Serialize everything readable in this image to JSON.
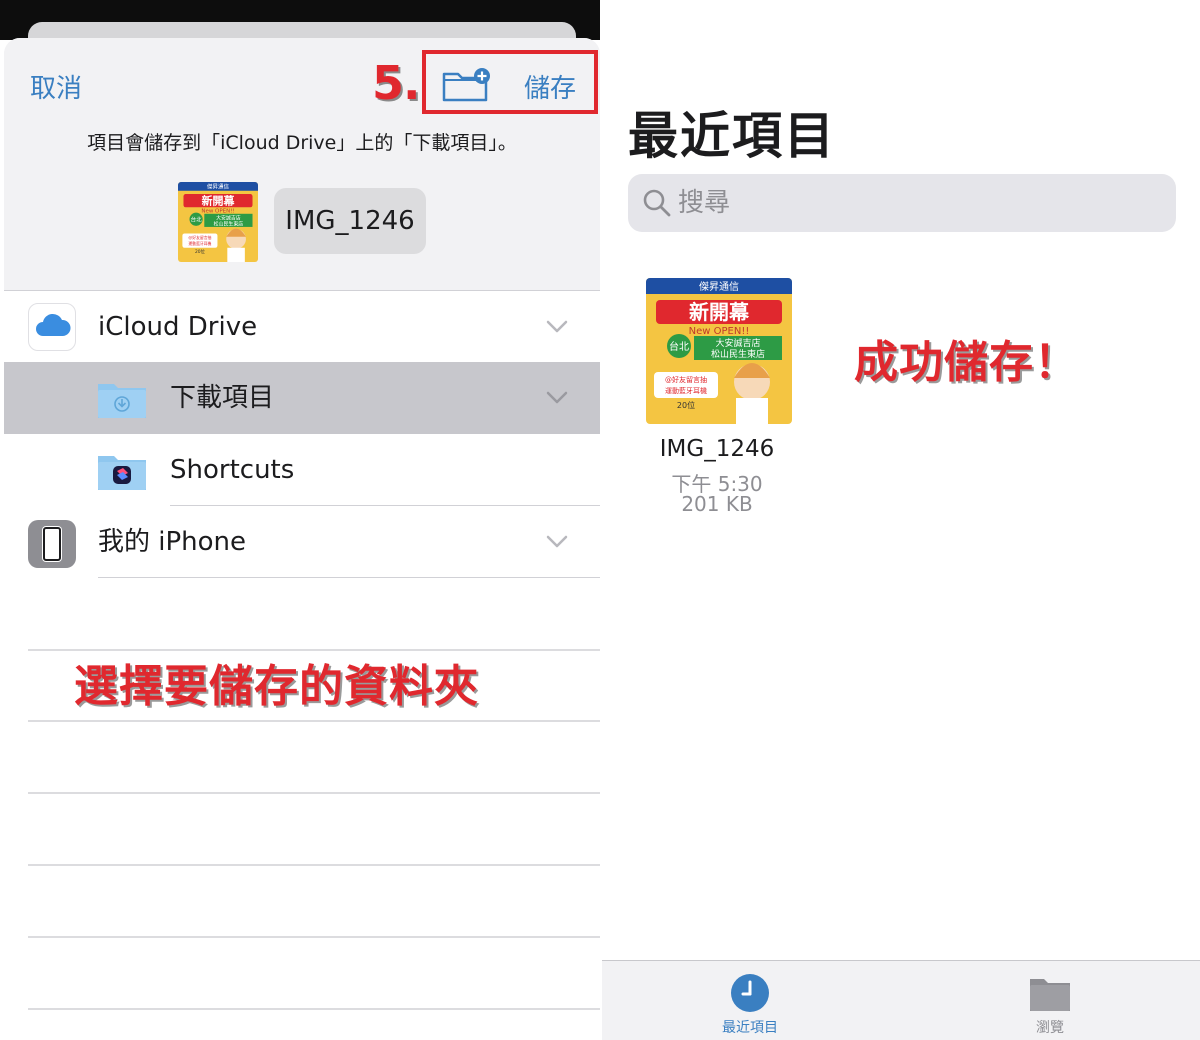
{
  "left": {
    "header": {
      "cancel_label": "取消",
      "step_label": "5.",
      "new_folder_icon": "folder-plus-icon",
      "save_label": "儲存"
    },
    "save_info": "項目會儲存到「iCloud Drive」上的「下載項目」。",
    "file": {
      "name": "IMG_1246",
      "thumbnail_icon": "image-thumbnail-icon"
    },
    "locations": [
      {
        "label": "iCloud Drive",
        "icon": "icloud-icon",
        "expanded": true
      },
      {
        "label": "下載項目",
        "icon": "download-folder-icon",
        "selected": true
      },
      {
        "label": "Shortcuts",
        "icon": "shortcuts-folder-icon"
      },
      {
        "label": "我的 iPhone",
        "icon": "iphone-icon",
        "expanded": false
      }
    ],
    "annotation": "選擇要儲存的資料夾"
  },
  "right": {
    "title": "最近項目",
    "search": {
      "placeholder": "搜尋"
    },
    "files": [
      {
        "name": "IMG_1246",
        "time": "下午 5:30",
        "size": "201 KB"
      }
    ],
    "annotation": "成功儲存！",
    "tabs": [
      {
        "label": "最近項目",
        "icon": "clock-icon",
        "active": true
      },
      {
        "label": "瀏覽",
        "icon": "folder-icon",
        "active": false
      }
    ]
  },
  "colors": {
    "accent": "#3a7fc1",
    "annotation": "#e0282e",
    "selected_row": "#c7c7cc",
    "sheet_bg": "#f2f2f4"
  },
  "thumbnail": {
    "banner": "傑昇通信",
    "headline": "新開幕",
    "subtitle": "New OPEN!!",
    "city": "台北",
    "store_1": "大安誠吉店",
    "store_2": "松山民生東店",
    "promo_1": "@好友留言抽",
    "promo_2": "運動藍牙耳機",
    "promo_3": "20位"
  }
}
